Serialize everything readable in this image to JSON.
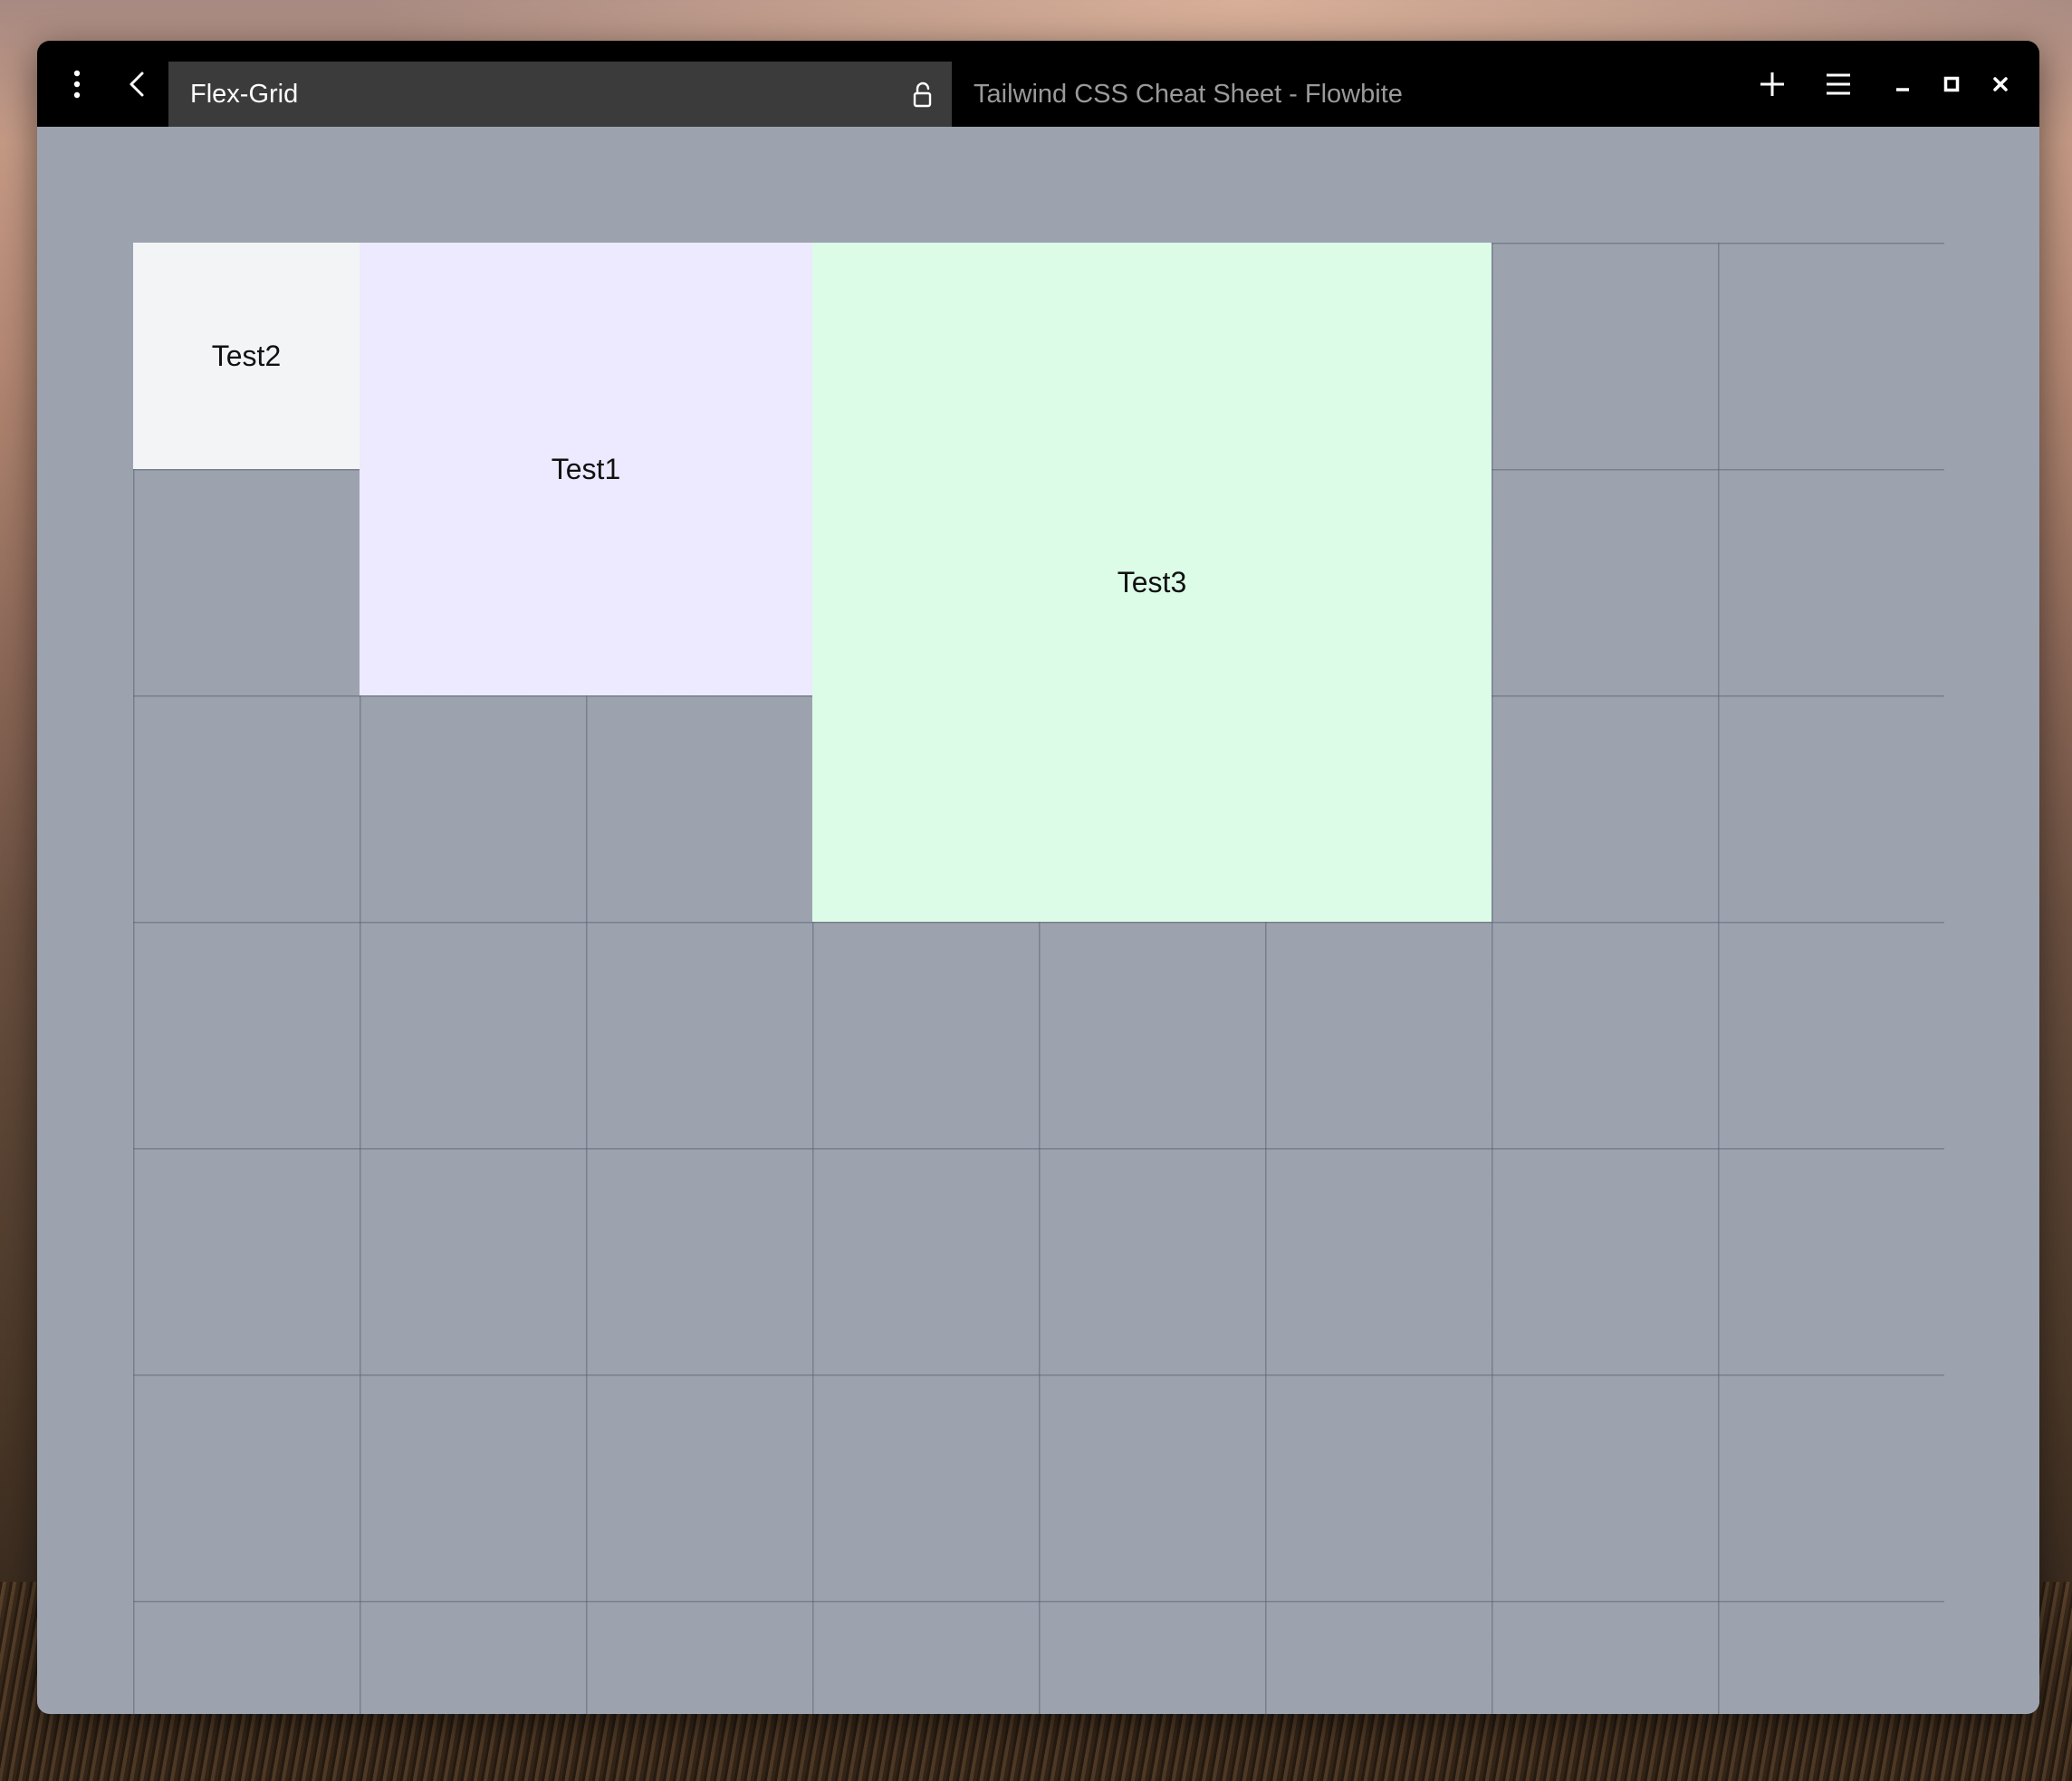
{
  "titlebar": {
    "active_tab": {
      "title": "Flex-Grid",
      "lock_icon": "lock-open-icon"
    },
    "inactive_tab": {
      "title": "Tailwind CSS Cheat Sheet - Flowbite"
    },
    "icons": {
      "menu": "vertical-dots-icon",
      "back": "chevron-left-icon",
      "new_tab": "plus-icon",
      "hamburger": "hamburger-menu-icon",
      "minimize": "minimize-icon",
      "maximize": "maximize-icon",
      "close": "close-icon"
    }
  },
  "content": {
    "grid_cells": [
      {
        "label": "Test2",
        "color": "#f3f4f6"
      },
      {
        "label": "Test1",
        "color": "#ede9fe"
      },
      {
        "label": "Test3",
        "color": "#dcfce7"
      }
    ],
    "background_color": "#9ca3af"
  }
}
